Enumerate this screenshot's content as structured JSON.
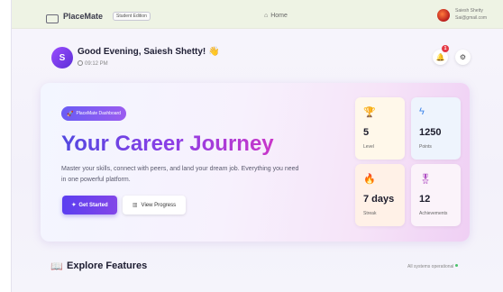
{
  "header": {
    "brand_name": "PlaceMate",
    "brand_badge": "Student Edition",
    "home_label": "Home",
    "user_name": "Saiesh Shetty",
    "user_email": "Sai@gmail.com"
  },
  "greeting": {
    "avatar_initial": "S",
    "title": "Good Evening, Saiesh Shetty!",
    "wave": "👋",
    "time": "09:12 PM",
    "notification_count": "1"
  },
  "hero": {
    "badge": "PlaceMate Dashboard",
    "title": "Your Career Journey",
    "description": "Master your skills, connect with peers, and land your dream job. Everything you need in one powerful platform.",
    "primary_button": "Get Started",
    "secondary_button": "View Progress"
  },
  "stats": [
    {
      "value": "5",
      "label": "Level",
      "icon": "trophy-icon"
    },
    {
      "value": "1250",
      "label": "Points",
      "icon": "bolt-icon"
    },
    {
      "value": "7 days",
      "label": "Streak",
      "icon": "flame-icon"
    },
    {
      "value": "12",
      "label": "Achievements",
      "icon": "award-icon"
    }
  ],
  "explore": {
    "title": "Explore Features",
    "status": "All systems operational"
  },
  "colors": {
    "accent": "#5b3ef0",
    "accent_pink": "#c936c9",
    "notification": "#e53945"
  }
}
